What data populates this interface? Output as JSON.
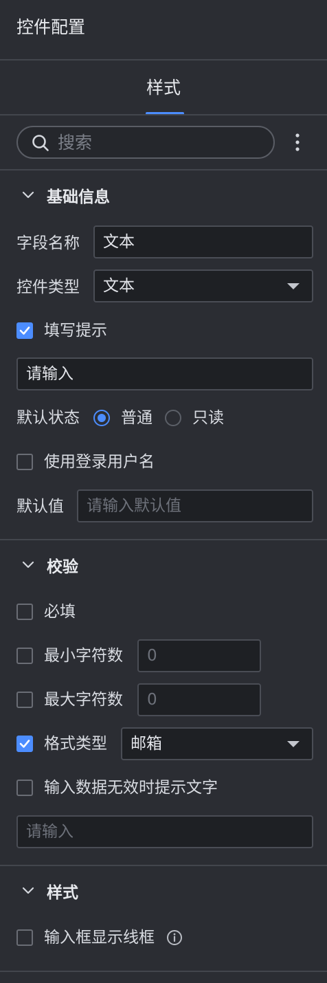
{
  "panel": {
    "title": "控件配置"
  },
  "tabs": [
    {
      "label": "样式",
      "active": true
    }
  ],
  "search": {
    "placeholder": "搜索"
  },
  "basic": {
    "title": "基础信息",
    "field_name_label": "字段名称",
    "field_name_value": "文本",
    "control_type_label": "控件类型",
    "control_type_value": "文本",
    "hint_checkbox_label": "填写提示",
    "hint_checked": true,
    "hint_value": "请输入",
    "default_state_label": "默认状态",
    "state_options": [
      {
        "label": "普通",
        "selected": true
      },
      {
        "label": "只读",
        "selected": false
      }
    ],
    "use_login_label": "使用登录用户名",
    "default_value_label": "默认值",
    "default_value_placeholder": "请输入默认值"
  },
  "validation": {
    "title": "校验",
    "required_label": "必填",
    "min_chars_label": "最小字符数",
    "min_chars_placeholder": "0",
    "max_chars_label": "最大字符数",
    "max_chars_placeholder": "0",
    "format_label": "格式类型",
    "format_checked": true,
    "format_value": "邮箱",
    "invalid_tip_label": "输入数据无效时提示文字",
    "invalid_tip_placeholder": "请输入"
  },
  "style": {
    "title": "样式",
    "show_border_label": "输入框显示线框"
  },
  "colors": {
    "accent": "#4c8dff",
    "background": "#2b2d33",
    "field": "#1e2024"
  }
}
